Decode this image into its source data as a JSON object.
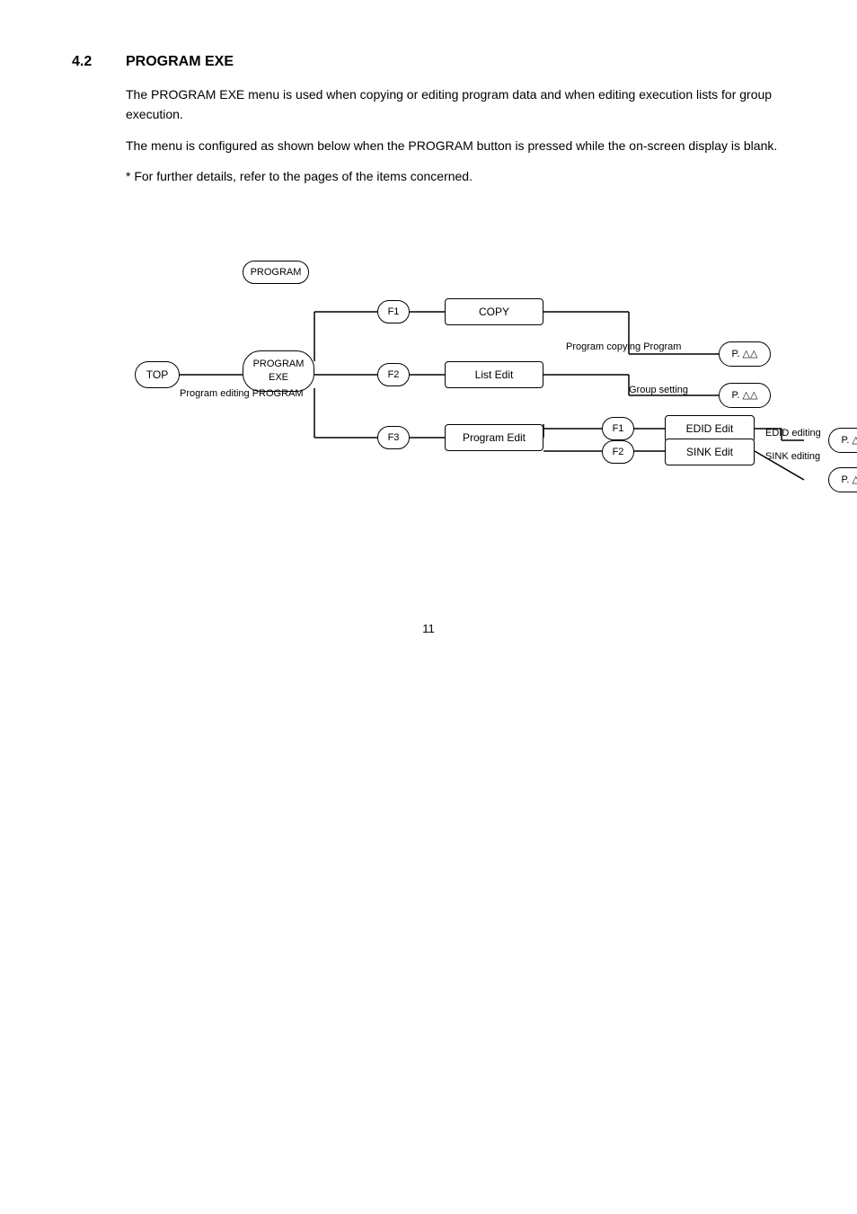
{
  "section": {
    "number": "4.2",
    "title": "PROGRAM EXE",
    "paragraph1": "The PROGRAM EXE menu is used when copying or editing program data and when editing execution lists for group execution.",
    "paragraph2": "The menu is configured as shown below when the PROGRAM button is pressed while the on-screen display is blank.",
    "note": "* For further details, refer to the pages of the items concerned."
  },
  "diagram": {
    "nodes": {
      "top": "TOP",
      "program": "PROGRAM",
      "program_exe": "PROGRAM\nEXE",
      "f1_1": "F1",
      "copy": "COPY",
      "f2_1": "F2",
      "list_edit": "List Edit",
      "f3": "F3",
      "program_edit": "Program Edit",
      "f1_2": "F1",
      "edid_edit": "EDID Edit",
      "f2_2": "F2",
      "sink_edit": "SINK Edit",
      "p1": "P. △△",
      "p2": "P. △△",
      "p3": "P. △△",
      "p4": "P. △△"
    },
    "labels": {
      "program_copying": "Program copying Program",
      "group_setting": "Group setting",
      "edid_editing": "EDID editing",
      "sink_editing": "SINK editing",
      "program_editing": "Program editing PROGRAM"
    }
  },
  "page_number": "11"
}
